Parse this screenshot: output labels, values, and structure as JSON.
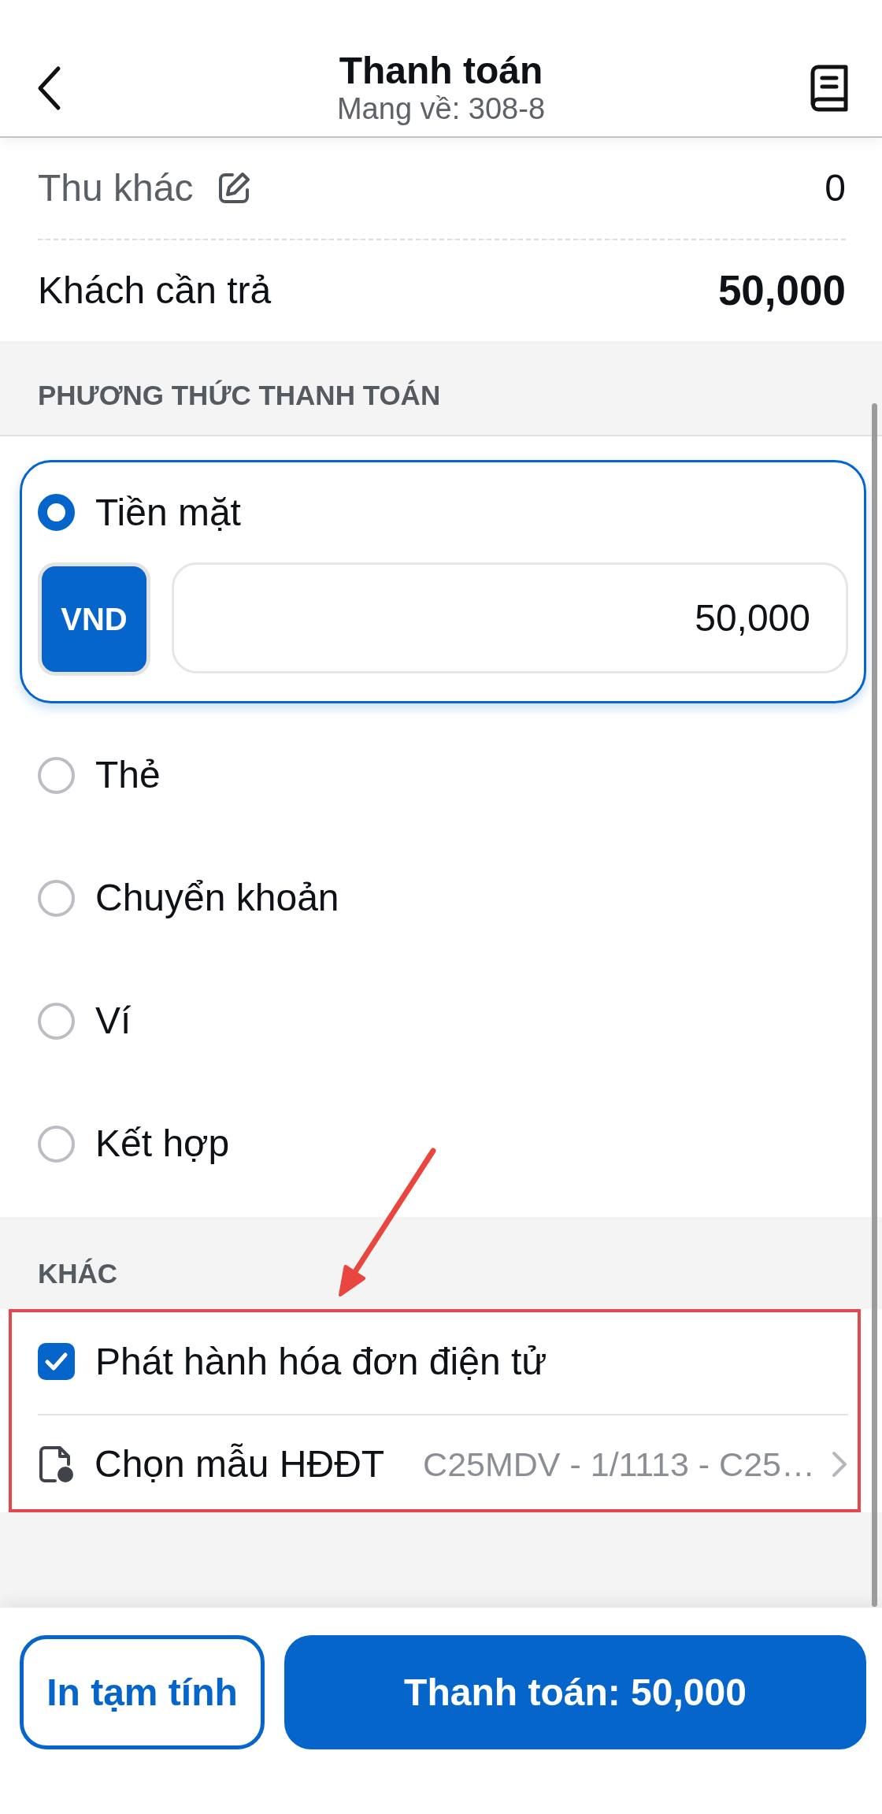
{
  "header": {
    "title": "Thanh toán",
    "subtitle": "Mang về: 308-8"
  },
  "summary": [
    {
      "kind": "editable",
      "label": "Thu khác",
      "value": "0"
    },
    {
      "kind": "total",
      "label": "Khách cần trả",
      "value": "50,000"
    }
  ],
  "payment_methods": {
    "heading": "PHƯƠNG THỨC THANH TOÁN",
    "options": [
      {
        "label": "Tiền mặt",
        "selected": true,
        "currency": "VND",
        "amount": "50,000"
      },
      {
        "label": "Thẻ",
        "selected": false
      },
      {
        "label": "Chuyển khoản",
        "selected": false
      },
      {
        "label": "Ví",
        "selected": false
      },
      {
        "label": "Kết hợp",
        "selected": false
      }
    ]
  },
  "other": {
    "heading": "KHÁC",
    "highlighted": true,
    "items": [
      {
        "kind": "checkbox",
        "label": "Phát hành hóa đơn điện tử",
        "checked": true
      },
      {
        "kind": "picker",
        "label": "Chọn mẫu HĐĐT",
        "value": "C25MDV - 1/1113 - C25…"
      }
    ]
  },
  "footer": {
    "buttons": [
      {
        "kind": "secondary",
        "label": "In tạm tính"
      },
      {
        "kind": "primary",
        "label": "Thanh toán: 50,000"
      }
    ]
  }
}
